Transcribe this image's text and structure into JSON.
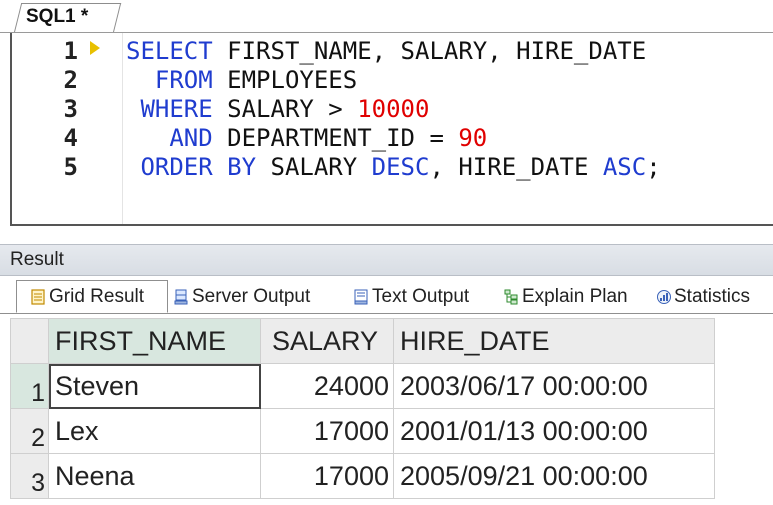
{
  "editor": {
    "tab_title": "SQL1 *",
    "line_numbers": [
      "1",
      "2",
      "3",
      "4",
      "5"
    ],
    "lines": [
      [
        {
          "t": "SELECT",
          "c": "kw"
        },
        {
          "t": " FIRST_NAME, SALARY, HIRE_DATE",
          "c": ""
        }
      ],
      [
        {
          "t": "  FROM",
          "c": "kw"
        },
        {
          "t": " EMPLOYEES",
          "c": ""
        }
      ],
      [
        {
          "t": " WHERE",
          "c": "kw"
        },
        {
          "t": " SALARY > ",
          "c": ""
        },
        {
          "t": "10000",
          "c": "num"
        }
      ],
      [
        {
          "t": "   AND",
          "c": "kw"
        },
        {
          "t": " DEPARTMENT_ID = ",
          "c": ""
        },
        {
          "t": "90",
          "c": "num"
        }
      ]
    ],
    "line5": [
      {
        "t": " ORDER",
        "c": "kw"
      },
      {
        "t": " ",
        "c": ""
      },
      {
        "t": "BY",
        "c": "kw"
      },
      {
        "t": " SALARY ",
        "c": ""
      },
      {
        "t": "DESC",
        "c": "kw"
      },
      {
        "t": ", HIRE_DATE ",
        "c": ""
      },
      {
        "t": "ASC",
        "c": "kw"
      },
      {
        "t": ";",
        "c": ""
      }
    ],
    "colors": {
      "keyword": "#1f3ccf",
      "number": "#e00000"
    }
  },
  "result": {
    "title": "Result",
    "tabs": [
      {
        "label": "Grid Result",
        "icon": "grid-result-icon",
        "active": true
      },
      {
        "label": "Server Output",
        "icon": "server-output-icon",
        "active": false
      },
      {
        "label": "Text Output",
        "icon": "text-output-icon",
        "active": false
      },
      {
        "label": "Explain Plan",
        "icon": "explain-plan-icon",
        "active": false
      },
      {
        "label": "Statistics",
        "icon": "statistics-icon",
        "active": false
      }
    ],
    "columns": [
      "FIRST_NAME",
      "SALARY",
      "HIRE_DATE"
    ],
    "rows": [
      {
        "num": "1",
        "first_name": "Steven",
        "salary": "24000",
        "hire_date": "2003/06/17 00:00:00"
      },
      {
        "num": "2",
        "first_name": "Lex",
        "salary": "17000",
        "hire_date": "2001/01/13 00:00:00"
      },
      {
        "num": "3",
        "first_name": "Neena",
        "salary": "17000",
        "hire_date": "2005/09/21 00:00:00"
      }
    ]
  }
}
